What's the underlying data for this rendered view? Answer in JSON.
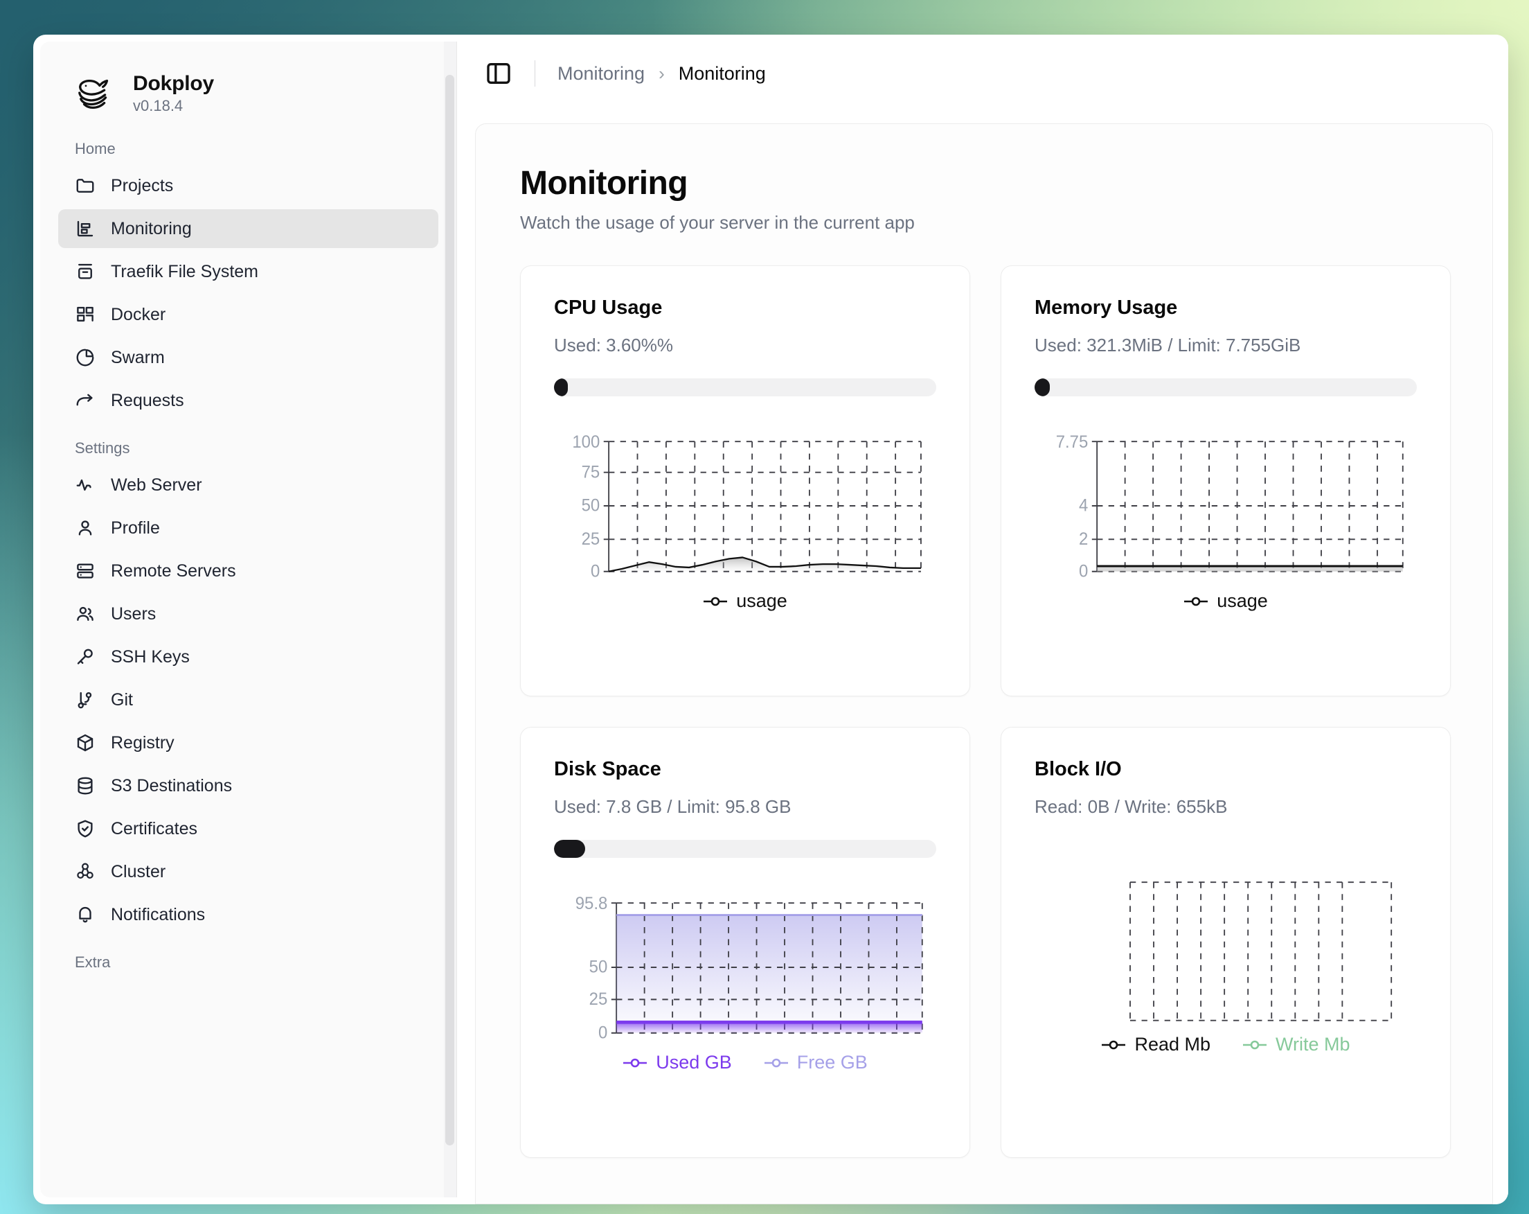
{
  "window": {
    "brand": {
      "name": "Dokploy",
      "version": "v0.18.4",
      "logo_icon": "whale-icon"
    }
  },
  "sidebar": {
    "groups": [
      {
        "label": "Home",
        "items": [
          {
            "label": "Projects",
            "icon": "folder-icon",
            "active": false
          },
          {
            "label": "Monitoring",
            "icon": "chart-bar-icon",
            "active": true
          },
          {
            "label": "Traefik File System",
            "icon": "archive-icon",
            "active": false
          },
          {
            "label": "Docker",
            "icon": "layout-grid-icon",
            "active": false
          },
          {
            "label": "Swarm",
            "icon": "pie-chart-icon",
            "active": false
          },
          {
            "label": "Requests",
            "icon": "arrow-forward-icon",
            "active": false
          }
        ]
      },
      {
        "label": "Settings",
        "items": [
          {
            "label": "Web Server",
            "icon": "activity-icon",
            "active": false
          },
          {
            "label": "Profile",
            "icon": "user-icon",
            "active": false
          },
          {
            "label": "Remote Servers",
            "icon": "server-icon",
            "active": false
          },
          {
            "label": "Users",
            "icon": "users-icon",
            "active": false
          },
          {
            "label": "SSH Keys",
            "icon": "key-icon",
            "active": false
          },
          {
            "label": "Git",
            "icon": "git-branch-icon",
            "active": false
          },
          {
            "label": "Registry",
            "icon": "package-icon",
            "active": false
          },
          {
            "label": "S3 Destinations",
            "icon": "database-icon",
            "active": false
          },
          {
            "label": "Certificates",
            "icon": "shield-check-icon",
            "active": false
          },
          {
            "label": "Cluster",
            "icon": "boxes-icon",
            "active": false
          },
          {
            "label": "Notifications",
            "icon": "bell-icon",
            "active": false
          }
        ]
      },
      {
        "label": "Extra",
        "items": []
      }
    ]
  },
  "topbar": {
    "panel_toggle_icon": "sidebar-panel-icon",
    "breadcrumb": {
      "parent": "Monitoring",
      "separator": "›",
      "current": "Monitoring"
    }
  },
  "page": {
    "title": "Monitoring",
    "subtitle": "Watch the usage of your server in the current app"
  },
  "cards": [
    {
      "id": "cpu-usage",
      "title": "CPU Usage",
      "subtitle": "Used: 3.60%%",
      "has_progress": true,
      "progress_percent": 3.6
    },
    {
      "id": "memory-usage",
      "title": "Memory Usage",
      "subtitle": "Used: 321.3MiB / Limit: 7.755GiB",
      "has_progress": true,
      "progress_percent": 4.0
    },
    {
      "id": "disk-space",
      "title": "Disk Space",
      "subtitle": "Used: 7.8 GB / Limit: 95.8 GB",
      "has_progress": true,
      "progress_percent": 8.1
    },
    {
      "id": "block-io",
      "title": "Block I/O",
      "subtitle": "Read: 0B / Write: 655kB",
      "has_progress": false,
      "progress_percent": 0
    }
  ],
  "colors": {
    "accent_purple": "#7C3AED",
    "accent_purple_light": "#A5A0E8",
    "accent_green": "#86C99A",
    "series_black": "#111111",
    "progress_fill": "#18181B",
    "grid_dash": "#3f3f46",
    "tick_label": "#9ca3af"
  },
  "chart_data": [
    {
      "id": "cpu-usage-chart",
      "type": "area",
      "title": "CPU Usage",
      "xlabel": "",
      "ylabel": "",
      "ylim": [
        0,
        100
      ],
      "yticks": [
        0,
        25,
        50,
        75,
        100
      ],
      "ytick_labels": [
        "0",
        "25",
        "50",
        "75",
        "100"
      ],
      "grid": true,
      "legend_position": "bottom",
      "series": [
        {
          "name": "usage",
          "color": "#111111",
          "values": [
            0,
            1.2,
            2.6,
            4.4,
            5.5,
            4.2,
            3.1,
            2.9,
            4.0,
            5.6,
            7.1,
            7.8,
            6.2,
            3.4,
            3.2,
            3.6,
            4.2,
            4.6,
            4.7,
            4.6,
            4.2,
            3.7,
            3.3,
            3.0
          ]
        }
      ]
    },
    {
      "id": "memory-usage-chart",
      "type": "area",
      "title": "Memory Usage",
      "xlabel": "",
      "ylabel": "",
      "ylim": [
        0,
        7.75
      ],
      "yticks": [
        0,
        2,
        4,
        7.75
      ],
      "ytick_labels": [
        "0",
        "2",
        "4",
        "7.75"
      ],
      "grid": true,
      "legend_position": "bottom",
      "series": [
        {
          "name": "usage",
          "color": "#111111",
          "values": [
            0.31,
            0.31,
            0.31,
            0.31,
            0.31,
            0.31,
            0.31,
            0.31,
            0.31,
            0.31,
            0.31,
            0.31,
            0.31,
            0.31,
            0.31,
            0.31,
            0.31,
            0.31,
            0.31,
            0.31,
            0.31,
            0.31,
            0.31,
            0.31
          ]
        }
      ]
    },
    {
      "id": "disk-space-chart",
      "type": "area",
      "title": "Disk Space",
      "xlabel": "",
      "ylabel": "",
      "ylim": [
        0,
        95.8
      ],
      "yticks": [
        0,
        25,
        50,
        95.8
      ],
      "ytick_labels": [
        "0",
        "25",
        "50",
        "95.8"
      ],
      "grid": true,
      "legend_position": "bottom",
      "series": [
        {
          "name": "Free GB",
          "color": "#A5A0E8",
          "values": [
            88,
            88,
            88,
            88,
            88,
            88,
            88,
            88,
            88,
            88,
            88,
            88,
            88,
            88,
            88,
            88,
            88,
            88,
            88,
            88,
            88,
            88,
            88,
            88
          ]
        },
        {
          "name": "Used GB",
          "color": "#7C3AED",
          "values": [
            7.8,
            7.8,
            7.8,
            7.8,
            7.8,
            7.8,
            7.8,
            7.8,
            7.8,
            7.8,
            7.8,
            7.8,
            7.8,
            7.8,
            7.8,
            7.8,
            7.8,
            7.8,
            7.8,
            7.8,
            7.8,
            7.8,
            7.8,
            7.8
          ]
        }
      ]
    },
    {
      "id": "block-io-chart",
      "type": "area",
      "title": "Block I/O",
      "xlabel": "",
      "ylabel": "",
      "ylim": [
        0,
        0
      ],
      "yticks": [],
      "ytick_labels": [],
      "grid": true,
      "legend_position": "bottom",
      "series": [
        {
          "name": "Read Mb",
          "color": "#111111",
          "values": []
        },
        {
          "name": "Write Mb",
          "color": "#86C99A",
          "values": []
        }
      ]
    }
  ]
}
